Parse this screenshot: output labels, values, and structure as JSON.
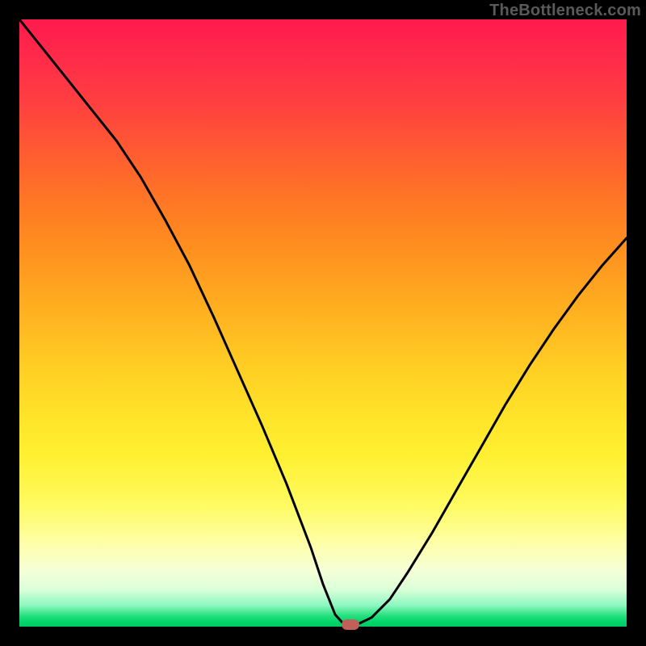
{
  "watermark": "TheBottleneck.com",
  "colors": {
    "curve": "#000000",
    "marker": "#c06058",
    "frame": "#000000"
  },
  "chart_data": {
    "type": "line",
    "title": "",
    "xlabel": "",
    "ylabel": "",
    "xlim": [
      0,
      100
    ],
    "ylim": [
      0,
      100
    ],
    "grid": false,
    "legend": false,
    "background_gradient": {
      "top": "#ff1a4d",
      "middle": "#ffd024",
      "bottom": "#00c864",
      "note": "vertical gradient red→orange→yellow→green; implied meaning: higher y = worse (bottleneck), near 0 = optimal"
    },
    "x": [
      0,
      4,
      8,
      12,
      16,
      20,
      24,
      28,
      32,
      36,
      40,
      44,
      48,
      50,
      52,
      53.5,
      55.5,
      58,
      61,
      64,
      68,
      72,
      76,
      80,
      84,
      88,
      92,
      96,
      100
    ],
    "values": [
      100,
      95,
      90,
      85,
      80,
      74,
      67,
      59.5,
      51,
      42,
      33,
      23.5,
      13,
      7,
      2,
      0.3,
      0.3,
      1.5,
      4.5,
      9,
      15.5,
      22.5,
      29.5,
      36.5,
      43,
      49,
      54.5,
      59.5,
      64
    ],
    "note": "Values are approximate percentages read from the vertical position of the curve (0 = bottom/green, 100 = top/red). The curve is a V-shaped dip reaching ~0 near x≈54.",
    "marker": {
      "x": 54.5,
      "y": 0.3
    }
  }
}
